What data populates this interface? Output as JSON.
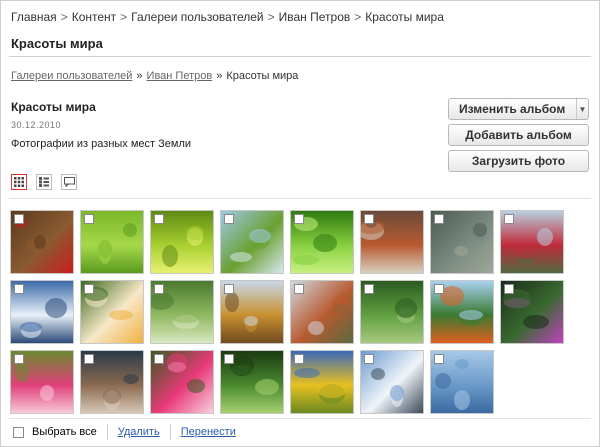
{
  "breadcrumb_top": [
    "Главная",
    "Контент",
    "Галереи пользователей",
    "Иван Петров",
    "Красоты мира"
  ],
  "page_title": "Красоты мира",
  "breadcrumb_nav": {
    "links": [
      "Галереи пользователей",
      "Иван Петров"
    ],
    "current": "Красоты мира",
    "separator": "»"
  },
  "album": {
    "name": "Красоты мира",
    "date": "30.12.2010",
    "description": "Фотографии из разных мест Земли"
  },
  "buttons": {
    "edit": "Изменить альбом",
    "add": "Добавить альбом",
    "upload": "Загрузить фото"
  },
  "view_modes": [
    {
      "name": "grid-view-icon",
      "active": true
    },
    {
      "name": "list-view-icon",
      "active": false
    },
    {
      "name": "comments-view-icon",
      "active": false
    }
  ],
  "photos": [
    {
      "subject": "red flowers",
      "colors": [
        "#5a3a1e",
        "#8a5a30",
        "#c81e1e"
      ],
      "checked": false
    },
    {
      "subject": "green leaf",
      "colors": [
        "#7ab82a",
        "#a6d84a",
        "#5b9a1e"
      ],
      "checked": false
    },
    {
      "subject": "grass blades",
      "colors": [
        "#5e8a12",
        "#a8d030",
        "#e8f070"
      ],
      "checked": false
    },
    {
      "subject": "leaves and sky",
      "colors": [
        "#9ec8e8",
        "#6aa030",
        "#d8e8f0"
      ],
      "checked": false
    },
    {
      "subject": "water drop on leaf",
      "colors": [
        "#2e7a10",
        "#88d040",
        "#c8f080"
      ],
      "checked": false
    },
    {
      "subject": "old houses",
      "colors": [
        "#6a4a3a",
        "#b85a30",
        "#d8d0c0"
      ],
      "checked": false
    },
    {
      "subject": "shallow water",
      "colors": [
        "#4a5a50",
        "#7a8a80",
        "#a0a898"
      ],
      "checked": false
    },
    {
      "subject": "red flowers by sea",
      "colors": [
        "#b8d0e0",
        "#c02a3a",
        "#506a40"
      ],
      "checked": false
    },
    {
      "subject": "snowy mountains",
      "colors": [
        "#3a6aa8",
        "#e8f0f8",
        "#2a4a78"
      ],
      "checked": false
    },
    {
      "subject": "frangipani flowers",
      "colors": [
        "#3a6a20",
        "#f8e8c8",
        "#f0b040"
      ],
      "checked": false
    },
    {
      "subject": "garden path",
      "colors": [
        "#4a7a30",
        "#90b860",
        "#d8e8c0"
      ],
      "checked": false
    },
    {
      "subject": "buddha statue",
      "colors": [
        "#c8d8e8",
        "#c89030",
        "#704a20"
      ],
      "checked": false
    },
    {
      "subject": "temple",
      "colors": [
        "#d0d8e0",
        "#b85a30",
        "#5a6a40"
      ],
      "checked": false
    },
    {
      "subject": "pineapple plant",
      "colors": [
        "#2a5a20",
        "#60a040",
        "#a8c880"
      ],
      "checked": false
    },
    {
      "subject": "tree by lake",
      "colors": [
        "#a8d0f0",
        "#3a7a30",
        "#e06020"
      ],
      "checked": false
    },
    {
      "subject": "pink flower",
      "colors": [
        "#1a2a1a",
        "#3a6a30",
        "#c040c0"
      ],
      "checked": false
    },
    {
      "subject": "pink flowers",
      "colors": [
        "#6a8a30",
        "#e0407a",
        "#f8c8d8"
      ],
      "checked": false
    },
    {
      "subject": "lionfish",
      "colors": [
        "#2a3a4a",
        "#8a6a50",
        "#d8c8b8"
      ],
      "checked": false
    },
    {
      "subject": "pink frangipani",
      "colors": [
        "#3a5a20",
        "#e83a78",
        "#f8d0e0"
      ],
      "checked": false
    },
    {
      "subject": "green leaves",
      "colors": [
        "#1a3a10",
        "#4a8a30",
        "#a8d070"
      ],
      "checked": false
    },
    {
      "subject": "yellow tree",
      "colors": [
        "#3a6ab8",
        "#e8c020",
        "#6a8a20"
      ],
      "checked": false
    },
    {
      "subject": "mountain peaks",
      "colors": [
        "#6a9ad0",
        "#f0f4f8",
        "#3a4a5a"
      ],
      "checked": false
    },
    {
      "subject": "calm sea",
      "colors": [
        "#a8c8e8",
        "#6a9ac8",
        "#3a6aa0"
      ],
      "checked": false
    }
  ],
  "actions": {
    "select_all": "Выбрать все",
    "delete": "Удалить",
    "move": "Перенести"
  }
}
